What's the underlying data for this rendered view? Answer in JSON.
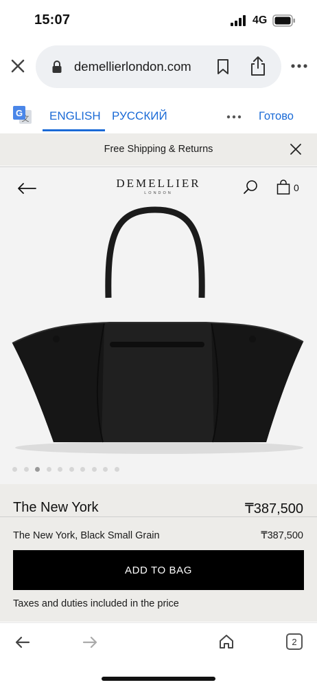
{
  "status_bar": {
    "time": "15:07",
    "network": "4G"
  },
  "browser": {
    "url": "demellierlondon.com"
  },
  "translate": {
    "tab_english": "ENGLISH",
    "tab_russian": "РУССКИЙ",
    "done_label": "Готово"
  },
  "banner": {
    "text": "Free Shipping & Returns"
  },
  "site": {
    "logo_main": "DEMELLIER",
    "logo_sub": "LONDON",
    "cart_count": "0"
  },
  "gallery": {
    "image_count": 10,
    "active_index": 2
  },
  "product": {
    "name": "The New York",
    "price": "₸387,500",
    "variant_name": "The New York, Black Small Grain",
    "variant_price": "₸387,500",
    "add_to_bag_label": "ADD TO BAG",
    "taxes_note": "Taxes and duties included in the price"
  },
  "toolbar": {
    "tab_count": "2"
  }
}
